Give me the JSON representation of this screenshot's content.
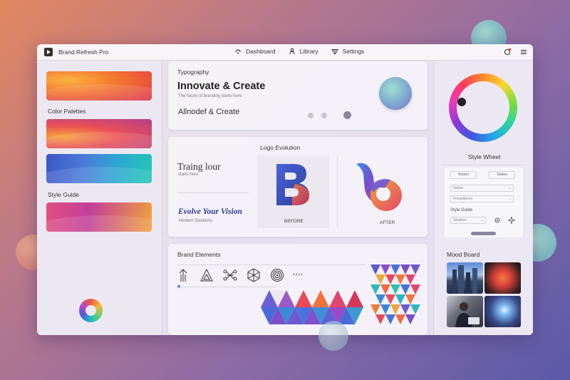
{
  "app": {
    "title": "Brand Refresh Pro"
  },
  "nav": [
    {
      "label": "Dashboard",
      "icon": "dashboard-icon"
    },
    {
      "label": "Library",
      "icon": "library-icon"
    },
    {
      "label": "Settings",
      "icon": "settings-icon"
    }
  ],
  "sidebar": {
    "color_palettes": "Color Palettes",
    "style_guide": "Style Guide"
  },
  "typography": {
    "heading": "Typography",
    "headline": "Innovate & Create",
    "tagline": "The future of branding starts here.",
    "alt_headline": "Allnodef & Create"
  },
  "logo_evolution": {
    "heading": "Logo Evolution",
    "script_title": "Traing lour",
    "script_sub": "starts here",
    "vision": "Evolve Your Vision",
    "vision_sub": "Modern Solutions",
    "before_letter": "B",
    "before_label": "BEFORE",
    "after_label": "AFTER"
  },
  "brand_elements": {
    "heading": "Brand Elements",
    "arrows": "››››"
  },
  "style_wheel": {
    "heading": "Style Wheel",
    "button1": "Button",
    "button2": "Sebes",
    "field1": "Seiton",
    "field2": "Freweitnson",
    "style_guide": "Style Guide",
    "field3": "Struiben"
  },
  "mood_board": {
    "heading": "Mood Board"
  },
  "colors": {
    "accent": "#3b58c0",
    "window_bg": "#eeebf4"
  }
}
